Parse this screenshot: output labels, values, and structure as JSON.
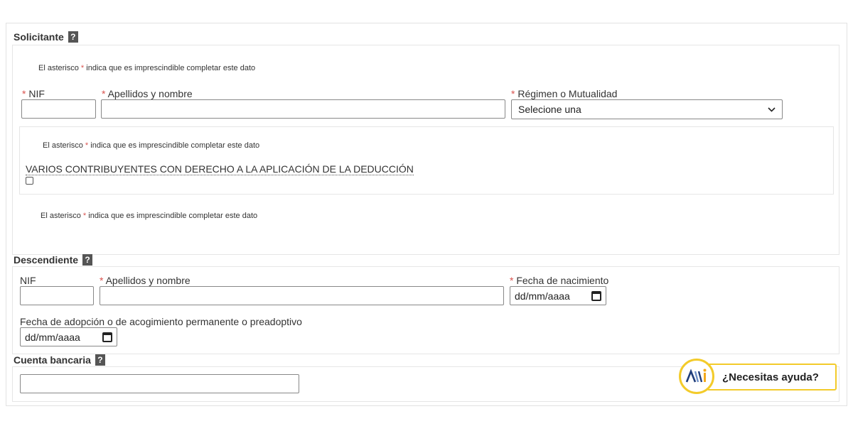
{
  "note": {
    "prefix": "El asterisco",
    "star": "*",
    "suffix": "indica que es imprescindible completar este dato"
  },
  "required_mark": "*",
  "solicitante": {
    "title": "Solicitante",
    "help": "?",
    "nif_label": "NIF",
    "nombre_label": "Apellidos y nombre",
    "regimen_label": "Régimen o Mutualidad",
    "regimen_value": "Selecione una",
    "varios_label": "VARIOS CONTRIBUYENTES CON DERECHO A LA APLICACIÓN DE LA DEDUCCIÓN"
  },
  "descendiente": {
    "title": "Descendiente",
    "help": "?",
    "nif_label": "NIF",
    "nombre_label": "Apellidos y nombre",
    "fecha_nac_label": "Fecha de nacimiento",
    "fecha_nac_value": "dd/mm/aaaa",
    "fecha_adop_label": "Fecha de adopción o de acogimiento permanente o preadoptivo",
    "fecha_adop_value": "dd/mm/aaaa"
  },
  "cuenta": {
    "title": "Cuenta bancaria",
    "help": "?"
  },
  "assistant": {
    "label": "¿Necesitas ayuda?"
  },
  "icons": {
    "select_arrow": "chevron-down-icon",
    "calendar": "calendar-icon",
    "help": "help-icon"
  },
  "colors": {
    "required": "#d9534f",
    "assistant_border": "#f3cb2a"
  }
}
